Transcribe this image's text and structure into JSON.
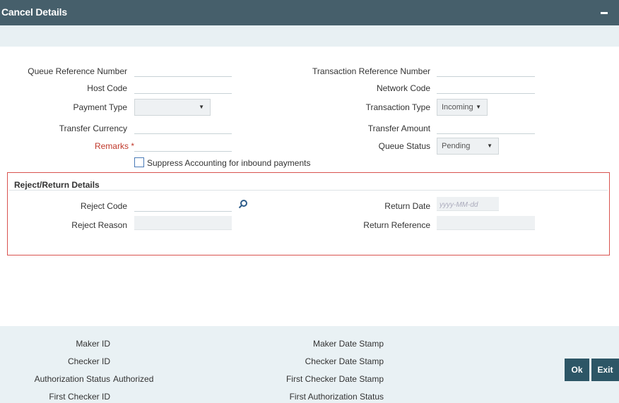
{
  "window": {
    "title": "Cancel Details"
  },
  "form": {
    "queue_reference_number": {
      "label": "Queue Reference Number",
      "value": ""
    },
    "host_code": {
      "label": "Host Code",
      "value": ""
    },
    "payment_type": {
      "label": "Payment Type",
      "value": ""
    },
    "transfer_currency": {
      "label": "Transfer Currency",
      "value": ""
    },
    "remarks": {
      "label": "Remarks",
      "required_mark": "*",
      "value": ""
    },
    "transaction_reference_number": {
      "label": "Transaction Reference Number",
      "value": ""
    },
    "network_code": {
      "label": "Network Code",
      "value": ""
    },
    "transaction_type": {
      "label": "Transaction Type",
      "value": "Incoming"
    },
    "transfer_amount": {
      "label": "Transfer Amount",
      "value": ""
    },
    "queue_status": {
      "label": "Queue Status",
      "value": "Pending"
    },
    "suppress_accounting": {
      "label": "Suppress Accounting for inbound payments",
      "checked": false
    }
  },
  "reject_return": {
    "legend": "Reject/Return Details",
    "reject_code": {
      "label": "Reject Code",
      "value": ""
    },
    "reject_reason": {
      "label": "Reject Reason",
      "value": ""
    },
    "return_date": {
      "label": "Return Date",
      "placeholder": "yyyy-MM-dd",
      "value": ""
    },
    "return_reference": {
      "label": "Return Reference",
      "value": ""
    }
  },
  "footer": {
    "maker_id": "Maker ID",
    "checker_id": "Checker ID",
    "authorization_status_label": "Authorization Status",
    "authorization_status_value": "Authorized",
    "first_checker_id": "First Checker ID",
    "maker_date_stamp": "Maker Date Stamp",
    "checker_date_stamp": "Checker Date Stamp",
    "first_checker_date_stamp": "First Checker Date Stamp",
    "first_authorization_status": "First Authorization Status"
  },
  "buttons": {
    "ok": "Ok",
    "exit": "Exit"
  },
  "icons": {
    "search": "search-icon",
    "minimize": "minimize-icon",
    "dropdown": "chevron-down-icon"
  },
  "colors": {
    "header_bg": "#465f6b",
    "required": "#c0392b",
    "section_border": "#d9534f",
    "button_bg": "#2d5666",
    "footer_bg": "#e9f1f4"
  }
}
